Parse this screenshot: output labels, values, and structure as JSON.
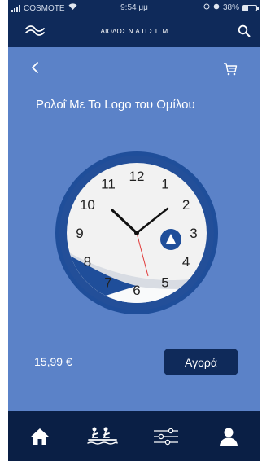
{
  "status": {
    "carrier": "COSMOTE",
    "time": "9:54 μμ",
    "battery": "38%",
    "battery_level": 0.38
  },
  "header": {
    "title": "ΑΙΟΛΟΣ Ν.Α.Π.Σ.Π.Μ",
    "logo_icon": "waves-icon",
    "search_icon": "search-icon"
  },
  "product": {
    "title": "Ρολοΐ Με Το Logo του Ομίλου",
    "price": "15,99 €",
    "buy_label": "Αγορά",
    "clock_numbers": [
      "12",
      "1",
      "2",
      "3",
      "4",
      "5",
      "6",
      "7",
      "8",
      "9",
      "10",
      "11"
    ]
  },
  "nav": {
    "back_icon": "chevron-left-icon",
    "cart_icon": "cart-icon",
    "tabs": [
      "home-icon",
      "rowing-icon",
      "sliders-icon",
      "user-icon"
    ]
  },
  "colors": {
    "background": "#5b82c8",
    "header": "#0f2a5a",
    "tabbar": "#0a1f45",
    "button": "#0f2a5a"
  }
}
